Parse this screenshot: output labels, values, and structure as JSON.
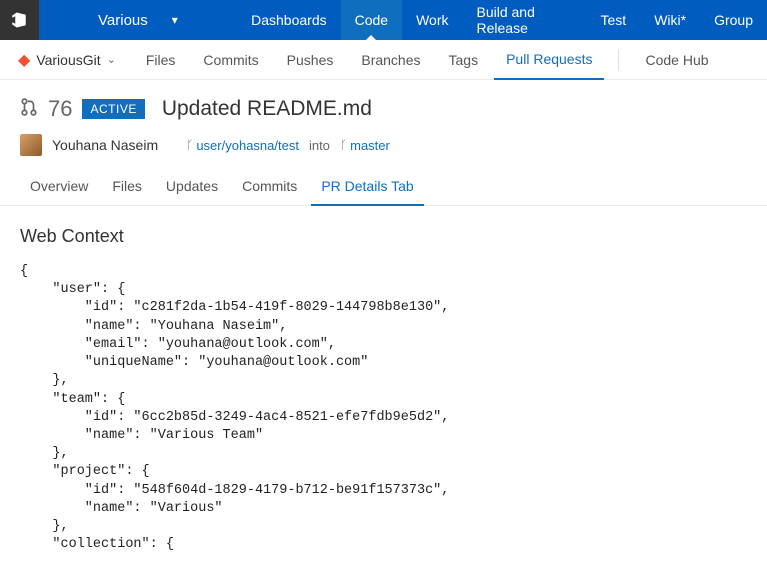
{
  "top": {
    "project_name": "Various",
    "hubs": [
      "Dashboards",
      "Code",
      "Work",
      "Build and Release",
      "Test",
      "Wiki*",
      "Group"
    ],
    "active_hub": "Code"
  },
  "repo_bar": {
    "repo_name": "VariousGit",
    "tabs": [
      "Files",
      "Commits",
      "Pushes",
      "Branches",
      "Tags",
      "Pull Requests"
    ],
    "active_tab": "Pull Requests",
    "extra": "Code Hub"
  },
  "pr": {
    "id": "76",
    "status": "ACTIVE",
    "title": "Updated README.md",
    "author": "Youhana Naseim",
    "source_branch": "user/yohasna/test",
    "into": "into",
    "target_branch": "master",
    "tabs": [
      "Overview",
      "Files",
      "Updates",
      "Commits",
      "PR Details Tab"
    ],
    "active_tab": "PR Details Tab"
  },
  "content": {
    "heading": "Web Context",
    "json_text": "{\n    \"user\": {\n        \"id\": \"c281f2da-1b54-419f-8029-144798b8e130\",\n        \"name\": \"Youhana Naseim\",\n        \"email\": \"youhana@outlook.com\",\n        \"uniqueName\": \"youhana@outlook.com\"\n    },\n    \"team\": {\n        \"id\": \"6cc2b85d-3249-4ac4-8521-efe7fdb9e5d2\",\n        \"name\": \"Various Team\"\n    },\n    \"project\": {\n        \"id\": \"548f604d-1829-4179-b712-be91f157373c\",\n        \"name\": \"Various\"\n    },\n    \"collection\": {"
  }
}
